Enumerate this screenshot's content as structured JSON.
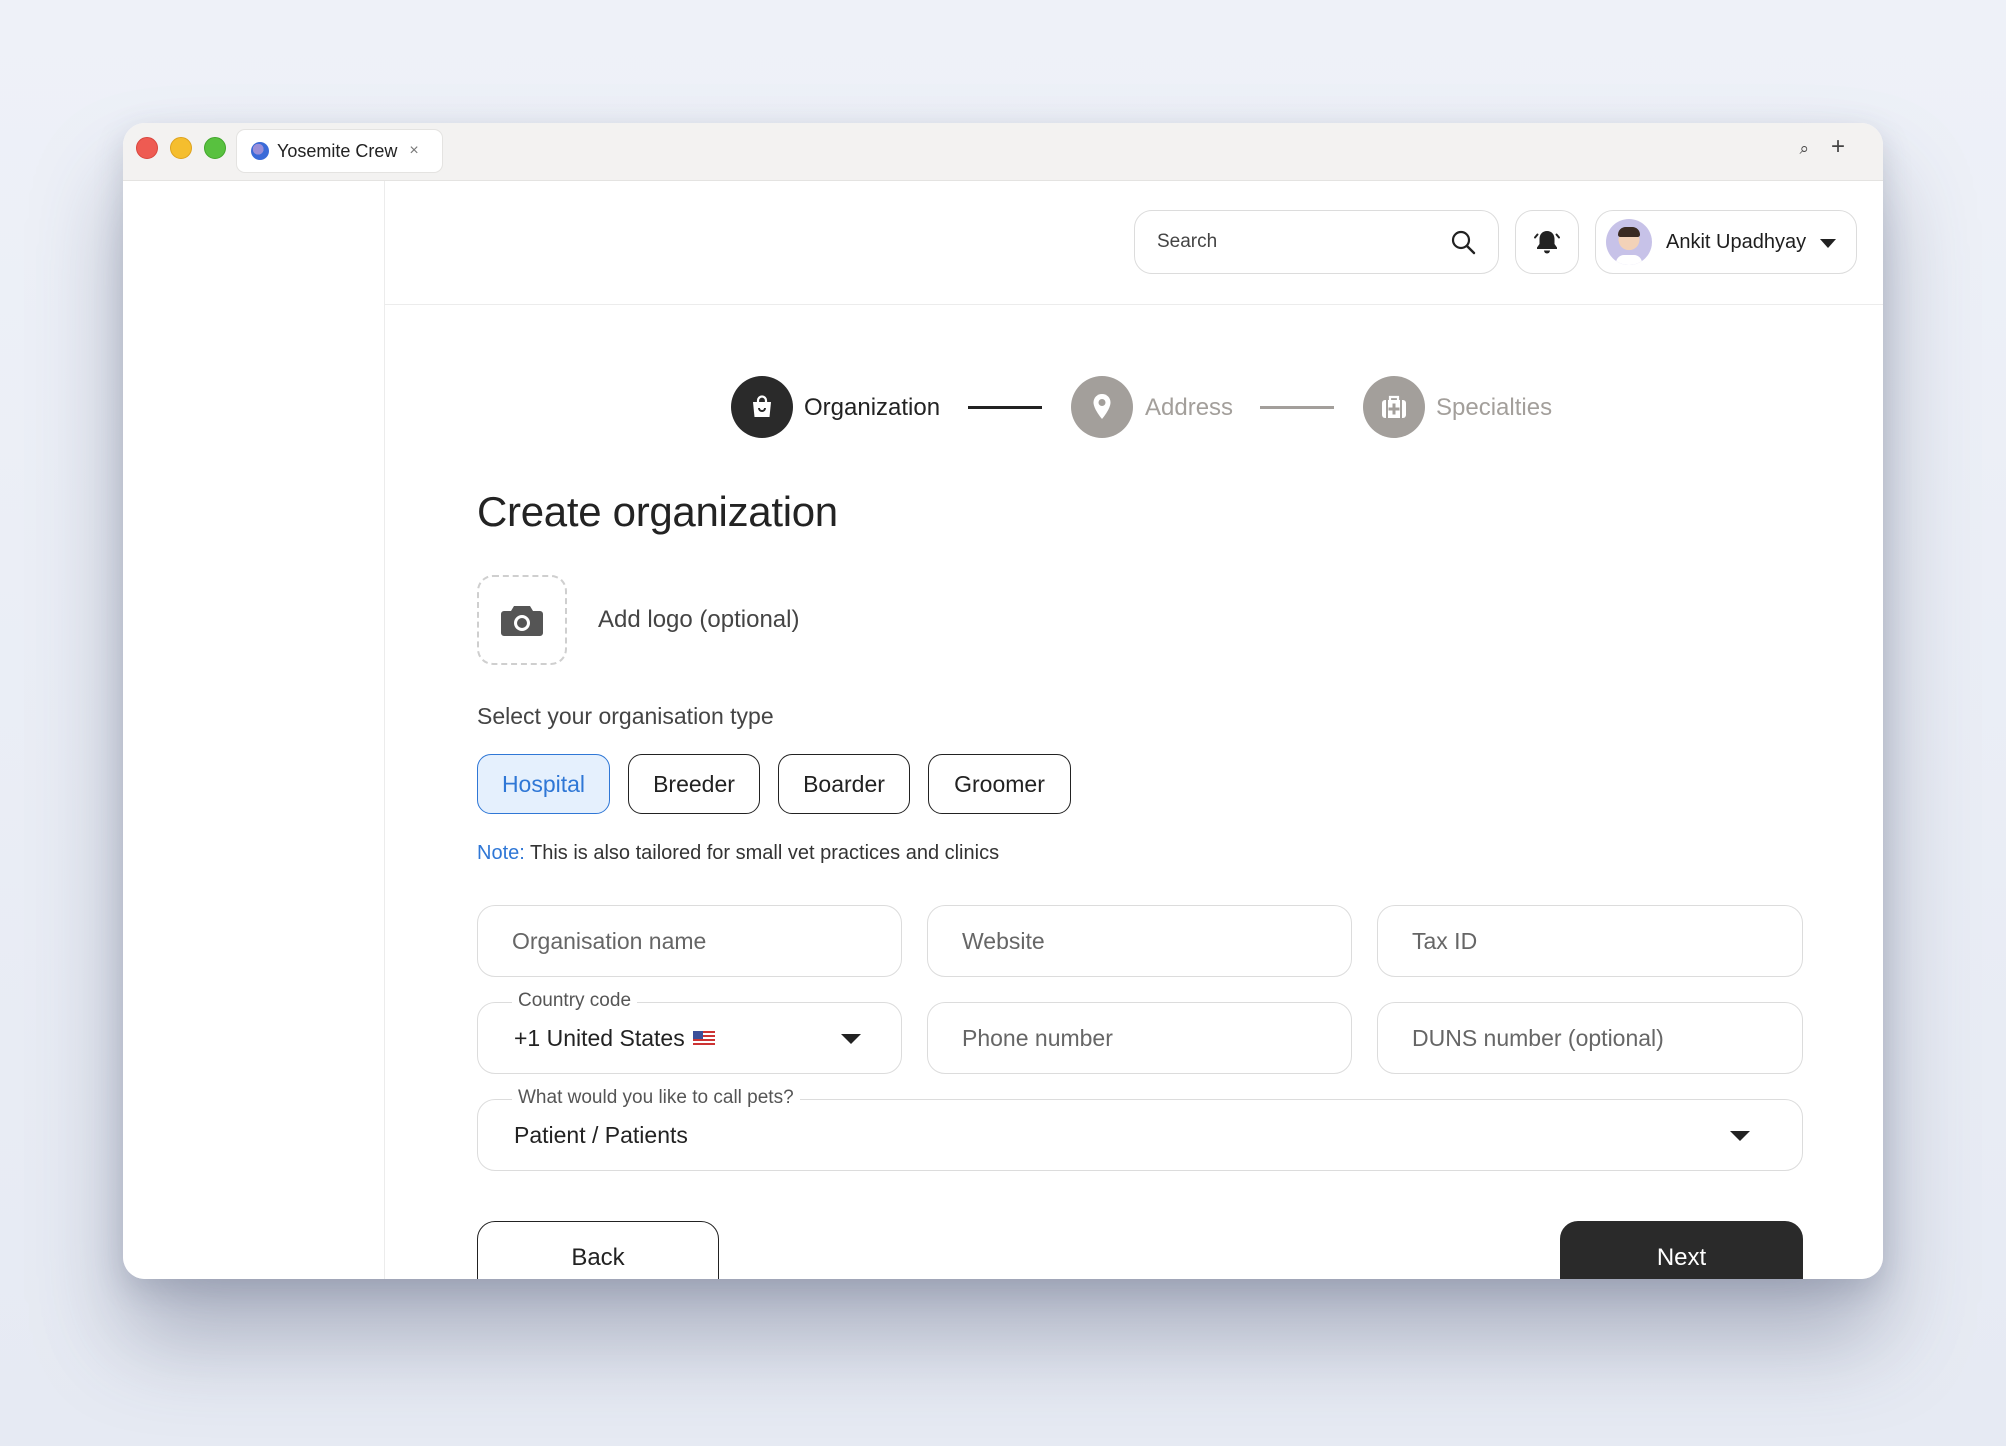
{
  "browser": {
    "tab_title": "Yosemite Crew",
    "tab_close": "×",
    "search_glyph": "⌕",
    "new_tab_glyph": "+"
  },
  "header": {
    "search_placeholder": "Search",
    "user_name": "Ankit Upadhyay"
  },
  "stepper": {
    "steps": [
      {
        "label": "Organization",
        "state": "active",
        "icon": "shopping-bag-icon"
      },
      {
        "label": "Address",
        "state": "inactive",
        "icon": "map-pin-icon"
      },
      {
        "label": "Specialties",
        "state": "inactive",
        "icon": "medical-kit-icon"
      }
    ]
  },
  "form": {
    "title": "Create organization",
    "add_logo": "Add logo (optional)",
    "type_label": "Select your organisation type",
    "types": [
      {
        "label": "Hospital",
        "selected": true
      },
      {
        "label": "Breeder",
        "selected": false
      },
      {
        "label": "Boarder",
        "selected": false
      },
      {
        "label": "Groomer",
        "selected": false
      }
    ],
    "note_label": "Note:",
    "note_text": " This is also tailored for small vet practices and clinics",
    "organisation_name_placeholder": "Organisation name",
    "website_placeholder": "Website",
    "tax_id_placeholder": "Tax ID",
    "country_code_label": "Country code",
    "country_code_value": "+1 United States",
    "phone_placeholder": "Phone number",
    "duns_placeholder": "DUNS number (optional)",
    "pets_label": "What would you like to call pets?",
    "pets_value": "Patient / Patients",
    "back_label": "Back",
    "next_label": "Next"
  },
  "colors": {
    "accent_blue": "#2f77d6",
    "active_chip_bg": "#e5f0fd",
    "dark": "#2a2a2a",
    "step_inactive": "#a39f9b"
  }
}
